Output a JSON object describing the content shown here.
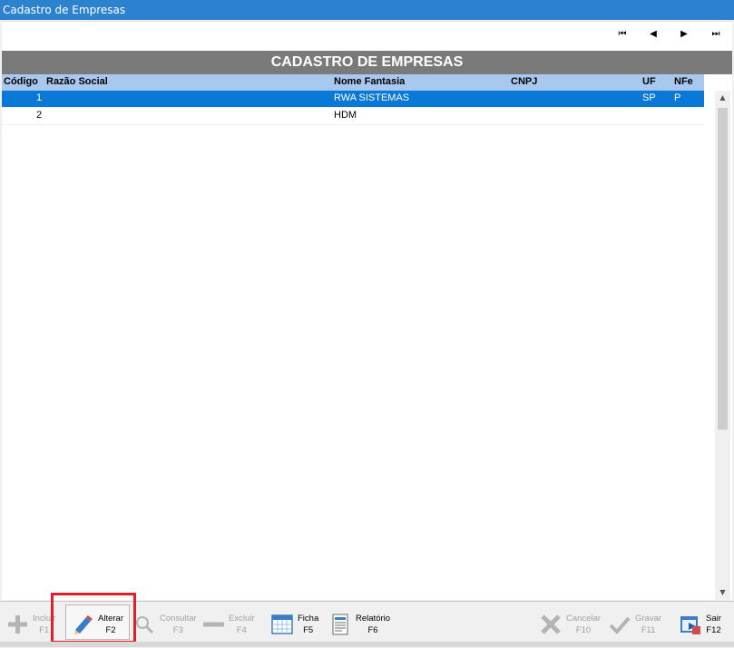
{
  "window": {
    "title": "Cadastro de Empresas"
  },
  "nav": {
    "first": "⏮",
    "prev": "◀",
    "next": "▶",
    "last": "⏭"
  },
  "header": {
    "title": "CADASTRO DE EMPRESAS"
  },
  "grid": {
    "columns": [
      "Código",
      "Razão Social",
      "Nome Fantasia",
      "CNPJ",
      "UF",
      "NFe"
    ],
    "rows": [
      {
        "codigo": "1",
        "razao": "",
        "fantasia": "RWA SISTEMAS",
        "cnpj": "",
        "uf": "SP",
        "nfe": "P"
      },
      {
        "codigo": "2",
        "razao": "",
        "fantasia": "HDM",
        "cnpj": "",
        "uf": "",
        "nfe": ""
      }
    ]
  },
  "toolbar": {
    "incluir": {
      "label": "Incluir",
      "key": "F1",
      "icon": "plus-icon"
    },
    "alterar": {
      "label": "Alterar",
      "key": "F2",
      "icon": "pencil-icon"
    },
    "consultar": {
      "label": "Consultar",
      "key": "F3",
      "icon": "search-icon"
    },
    "excluir": {
      "label": "Excluir",
      "key": "F4",
      "icon": "minus-icon"
    },
    "ficha": {
      "label": "Ficha",
      "key": "F5",
      "icon": "calendar-icon"
    },
    "relatorio": {
      "label": "Relatório",
      "key": "F6",
      "icon": "report-icon"
    },
    "cancelar": {
      "label": "Cancelar",
      "key": "F10",
      "icon": "x-icon"
    },
    "gravar": {
      "label": "Gravar",
      "key": "F11",
      "icon": "check-icon"
    },
    "sair": {
      "label": "Sair",
      "key": "F12",
      "icon": "exit-icon"
    }
  },
  "colors": {
    "titlebar": "#2d82d0",
    "selected_row": "#0a78d7",
    "grid_header": "#a9c8f0",
    "banner": "#7a7a7a",
    "highlight": "#e0202a"
  }
}
